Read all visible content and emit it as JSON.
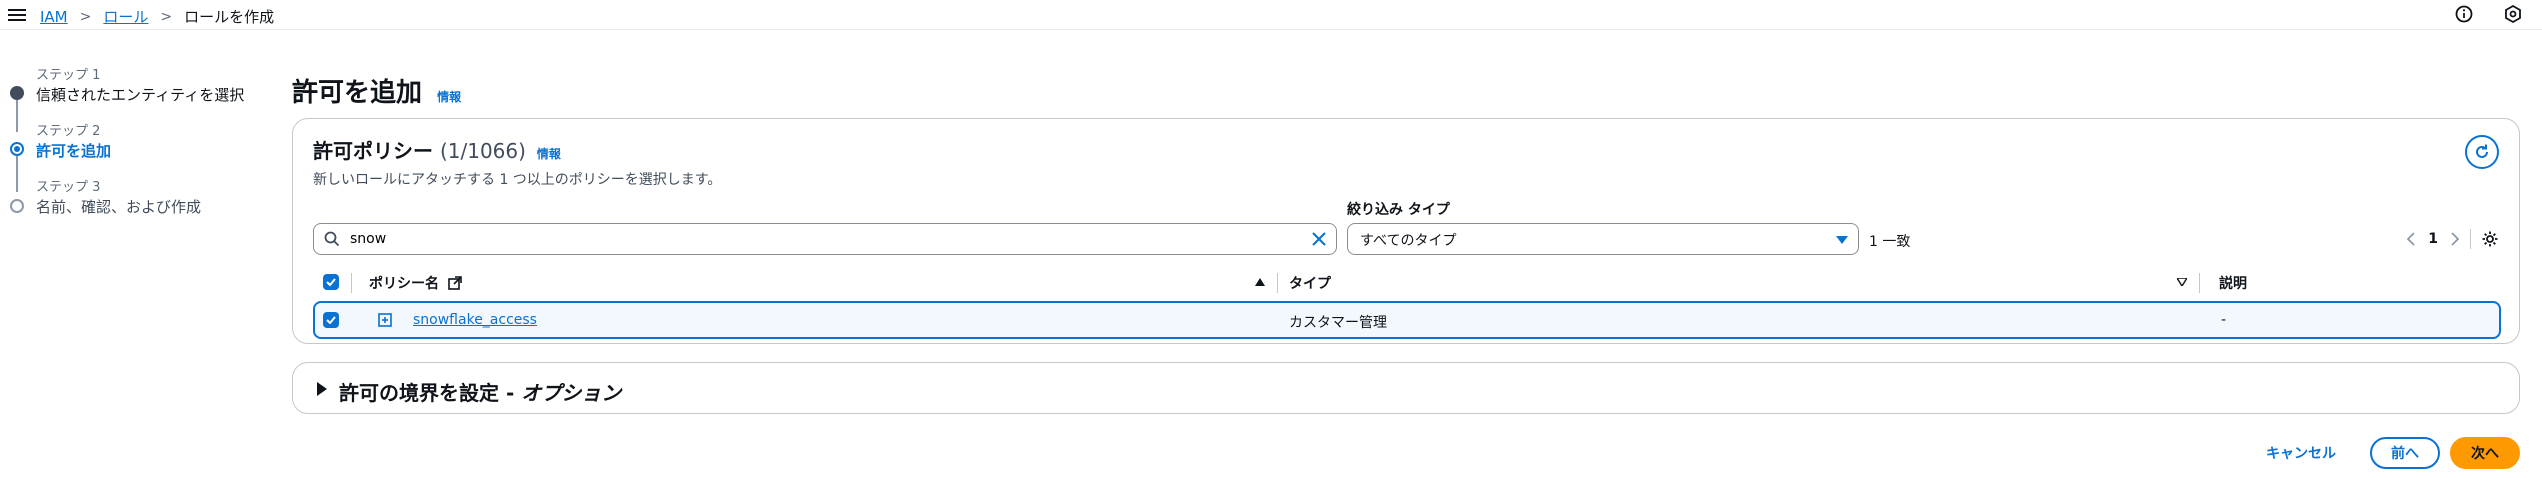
{
  "breadcrumb": {
    "items": [
      "IAM",
      "ロール"
    ],
    "current": "ロールを作成"
  },
  "steps": [
    {
      "num": "ステップ 1",
      "title": "信頼されたエンティティを選択",
      "state": "completed"
    },
    {
      "num": "ステップ 2",
      "title": "許可を追加",
      "state": "current"
    },
    {
      "num": "ステップ 3",
      "title": "名前、確認、および作成",
      "state": "pending"
    }
  ],
  "page": {
    "title": "許可を追加",
    "info": "情報"
  },
  "policies": {
    "title": "許可ポリシー",
    "count": "(1/1066)",
    "info": "情報",
    "description": "新しいロールにアタッチする 1 つ以上のポリシーを選択します。",
    "search_value": "snow",
    "filter_label": "絞り込み タイプ",
    "filter_value": "すべてのタイプ",
    "match_count": "1 一致",
    "page_number": "1",
    "columns": {
      "name": "ポリシー名",
      "type": "タイプ",
      "description": "説明"
    },
    "rows": [
      {
        "name": "snowflake_access",
        "type": "カスタマー管理",
        "description": "-",
        "selected": true
      }
    ]
  },
  "boundary": {
    "title": "許可の境界を設定 - ",
    "option": "オプション"
  },
  "footer": {
    "cancel": "キャンセル",
    "previous": "前へ",
    "next": "次へ"
  },
  "colors": {
    "accent": "#0972d3",
    "primary_button": "#ff9900"
  }
}
